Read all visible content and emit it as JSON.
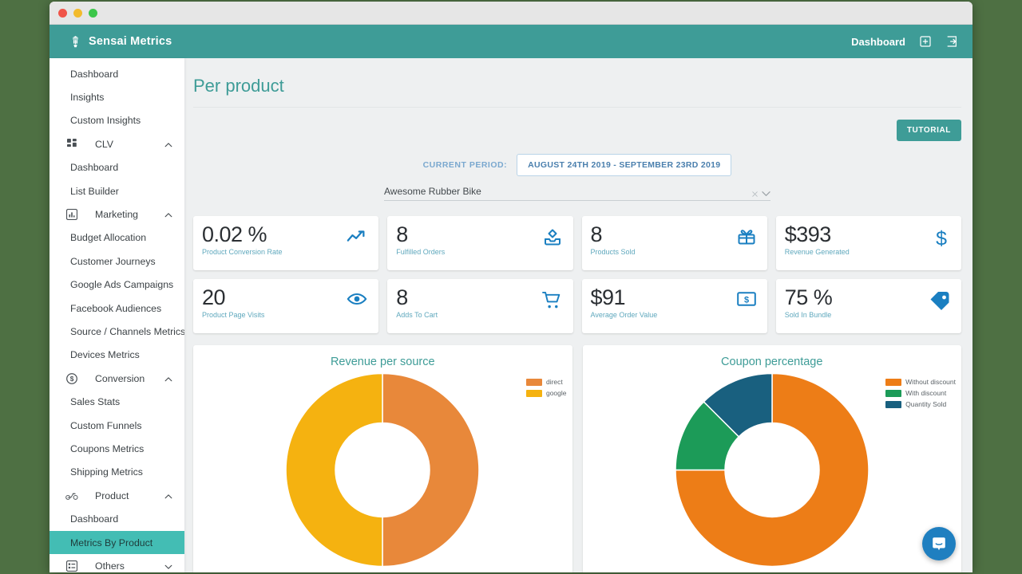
{
  "window": {
    "traffic_lights": [
      "close",
      "minimize",
      "maximize"
    ]
  },
  "header": {
    "brand": "Sensai Metrics",
    "logo_icon": "sensai-lantern-icon",
    "right_link": "Dashboard",
    "settings_icon": "gear-icon",
    "logout_icon": "logout-icon"
  },
  "sidebar": {
    "items": [
      {
        "type": "leaf",
        "label": "Dashboard",
        "active": false
      },
      {
        "type": "leaf",
        "label": "Insights",
        "active": false
      },
      {
        "type": "leaf",
        "label": "Custom Insights",
        "active": false
      },
      {
        "type": "group",
        "label": "CLV",
        "icon": "grid-icon",
        "expanded": true
      },
      {
        "type": "leaf",
        "label": "Dashboard",
        "active": false
      },
      {
        "type": "leaf",
        "label": "List Builder",
        "active": false
      },
      {
        "type": "group",
        "label": "Marketing",
        "icon": "bar-chart-icon",
        "expanded": true
      },
      {
        "type": "leaf",
        "label": "Budget Allocation",
        "active": false
      },
      {
        "type": "leaf",
        "label": "Customer Journeys",
        "active": false
      },
      {
        "type": "leaf",
        "label": "Google Ads Campaigns",
        "active": false
      },
      {
        "type": "leaf",
        "label": "Facebook Audiences",
        "active": false
      },
      {
        "type": "leaf",
        "label": "Source / Channels Metrics",
        "active": false
      },
      {
        "type": "leaf",
        "label": "Devices Metrics",
        "active": false
      },
      {
        "type": "group",
        "label": "Conversion",
        "icon": "dollar-circle-icon",
        "expanded": true
      },
      {
        "type": "leaf",
        "label": "Sales Stats",
        "active": false
      },
      {
        "type": "leaf",
        "label": "Custom Funnels",
        "active": false
      },
      {
        "type": "leaf",
        "label": "Coupons Metrics",
        "active": false
      },
      {
        "type": "leaf",
        "label": "Shipping Metrics",
        "active": false
      },
      {
        "type": "group",
        "label": "Product",
        "icon": "bike-icon",
        "expanded": true
      },
      {
        "type": "leaf",
        "label": "Dashboard",
        "active": false
      },
      {
        "type": "leaf",
        "label": "Metrics By Product",
        "active": true
      },
      {
        "type": "group",
        "label": "Others",
        "icon": "list-icon",
        "expanded": false
      }
    ]
  },
  "main": {
    "page_title": "Per product",
    "tutorial_button": "TUTORIAL",
    "period_label": "CURRENT PERIOD:",
    "period_value": "AUGUST 24TH 2019 - SEPTEMBER 23RD 2019",
    "product_selected": "Awesome Rubber Bike",
    "kpis": [
      {
        "value": "0.02 %",
        "label": "Product Conversion Rate",
        "icon": "trending-up-icon"
      },
      {
        "value": "8",
        "label": "Fulfilled Orders",
        "icon": "inbox-icon"
      },
      {
        "value": "8",
        "label": "Products Sold",
        "icon": "gift-icon"
      },
      {
        "value": "$393",
        "label": "Revenue Generated",
        "icon": "dollar-icon"
      },
      {
        "value": "20",
        "label": "Product Page Visits",
        "icon": "eye-icon"
      },
      {
        "value": "8",
        "label": "Adds To Cart",
        "icon": "cart-icon"
      },
      {
        "value": "$91",
        "label": "Average Order Value",
        "icon": "banknote-icon"
      },
      {
        "value": "75 %",
        "label": "Sold In Bundle",
        "icon": "tag-icon"
      }
    ],
    "chat_widget_icon": "intercom-chat-icon"
  },
  "chart_data": [
    {
      "type": "pie",
      "title": "Revenue per source",
      "donut": true,
      "legend_position": "top-right",
      "categories": [
        "direct",
        "google"
      ],
      "values": [
        50,
        50
      ],
      "colors": [
        "#e8883a",
        "#f5b210"
      ]
    },
    {
      "type": "pie",
      "title": "Coupon percentage",
      "donut": true,
      "legend_position": "top-right",
      "categories": [
        "Without discount",
        "With discount",
        "Quantity Sold"
      ],
      "values": [
        75,
        12.5,
        12.5
      ],
      "colors": [
        "#ed7d17",
        "#1c9b58",
        "#19607f"
      ]
    }
  ]
}
